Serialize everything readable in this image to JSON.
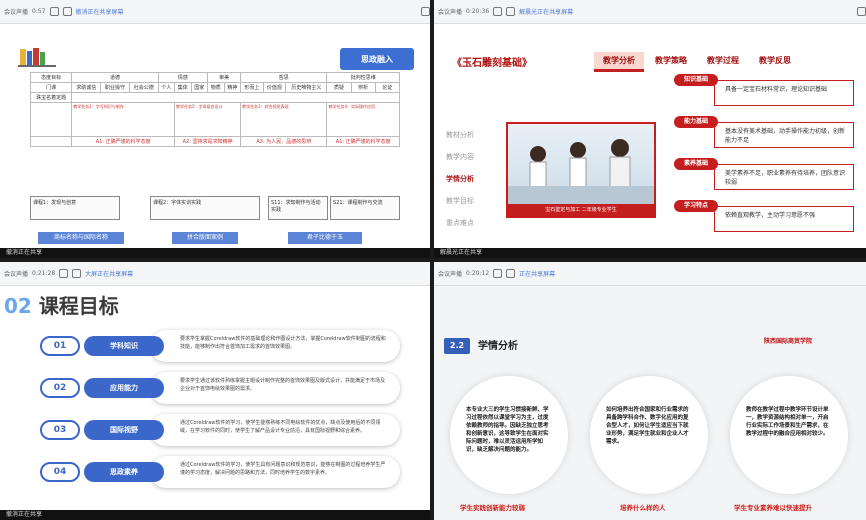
{
  "panes": {
    "p1": {
      "toolbar": {
        "user": "会议声播",
        "time": "0:57",
        "share": "撤消正在共享屏幕"
      },
      "footer": "撤消正在共享",
      "slide": {
        "title": "思政融入",
        "header_row": [
          "态度目标",
          "道德",
          "情感",
          "审美",
          "哲思",
          "批判性思维"
        ],
        "sub_row": [
          "门课",
          "求助诚信",
          "职业操守",
          "社会公德",
          "个人",
          "集体",
          "国家",
          "物质",
          "精神",
          "形而上",
          "价值观",
          "历史唯物主义",
          "质疑",
          "辨析",
          "论证"
        ],
        "row_label": "珠宝名着定题",
        "tasks": [
          "教学任务1：字号知识与制作",
          "教学任务2：字母组合设计",
          "教学任务3：综合视觉表现",
          "教学任务4：实际操作应用"
        ],
        "ideology": [
          "A1: 正确严谨的科学态度",
          "A2: 坚持求是求知精神",
          "A3: 为人民、品德的思辨",
          "A1: 正确严谨的科学态度"
        ],
        "subtasks": [
          "课程1：发现与创意",
          "课程2：字体实训实践",
          "S11：求知制作与活动实践",
          "S21：课程制作与交流"
        ],
        "captions": [
          "商标名称与国际名称",
          "拼合版面案例",
          "君子比德于玉"
        ]
      }
    },
    "p2": {
      "toolbar": {
        "user": "会议声播",
        "time": "0:20:36",
        "share": "解晨光正在共享屏幕"
      },
      "footer": "解晨光正在共享",
      "slide": {
        "title": "《玉石雕刻基础》",
        "tabs": [
          "教学分析",
          "教学策略",
          "教学过程",
          "教学反思"
        ],
        "side": [
          "教材分析",
          "教学内容",
          "学情分析",
          "教学目标",
          "重点难点"
        ],
        "photo_caption": "宝石鉴定与加工 二年级专业学生",
        "rows": [
          {
            "label": "知识基础",
            "text": "具备一定宝石材料常识，理论知识基础"
          },
          {
            "label": "能力基础",
            "text": "基本没有美术基础，动手操作能力初级，创新能力不足"
          },
          {
            "label": "素养基础",
            "text": "美学素养不足，职业素养有待培养，团队意识较弱"
          },
          {
            "label": "学习特点",
            "text": "依赖直观教学，主动学习意愿不强"
          }
        ]
      }
    },
    "p3": {
      "toolbar": {
        "user": "会议声播",
        "time": "0:21:28",
        "share": "大屏正在共享屏幕"
      },
      "footer": "撤消正在共享",
      "slide": {
        "num": "02",
        "title": "课程目标",
        "items": [
          {
            "n": "01",
            "label": "学科知识",
            "text": "要求学生掌握Coreldraw软件的基础理论和作图设计方法，掌握Coreldraw软件制图的流程和技能，能够制作出符合首饰加工需求的首饰效果图。"
          },
          {
            "n": "02",
            "label": "应用能力",
            "text": "要求学生通过该软件熟练掌握主题设计制作完整的首饰效果图及版式设计，并能满足于市场及企业对于首饰电绘效果图的需求。"
          },
          {
            "n": "03",
            "label": "国际视野",
            "text": "通过Coreldraw软件的学习，使学生能够熟练不同电绘软件的优点，缺点及使用后的不同领域，在学习软件的同时，使学生了解产品设计专业前沿，具有国际视野和综合素养。"
          },
          {
            "n": "04",
            "label": "思政素养",
            "text": "通过Coreldraw软件的学习，使学生具有问题意识和规范意识，能够在制图的过程培养学生严谨的学习态度，解决问题的思路和方法，同时培养学生的数字素养。"
          }
        ]
      }
    },
    "p4": {
      "toolbar": {
        "user": "会议声播",
        "time": "0:20:12",
        "share": "正在共享屏幕"
      },
      "slide": {
        "badge": "2.2",
        "title": "学情分析",
        "logo": "陕西国际商贸学院",
        "circles": [
          "本专业大三的学生习惯接新鲜、学习过程依然以课堂学习为主，过度依赖教师的指导。因缺乏独立思考和创新意识，这导致学生在面对实际问题时，难以灵活运用所学知识，缺乏解决问题的能力。",
          "如何培养出符合国家和行业需求的具备跨学科合作、数字化应用的复合型人才，如何让学生适应当下就业形势，满足学生就业和企业人才需求。",
          "教师在教学过程中教学环节设计单一，教学资源结构相对单一，开启行业实际工作场景和生产需求，在教学过程中的融合应用相对较少。"
        ],
        "bottoms": [
          "学生实践创新能力较弱",
          "培养什么样的人",
          "学生专业素养难以快速提升"
        ]
      }
    }
  }
}
